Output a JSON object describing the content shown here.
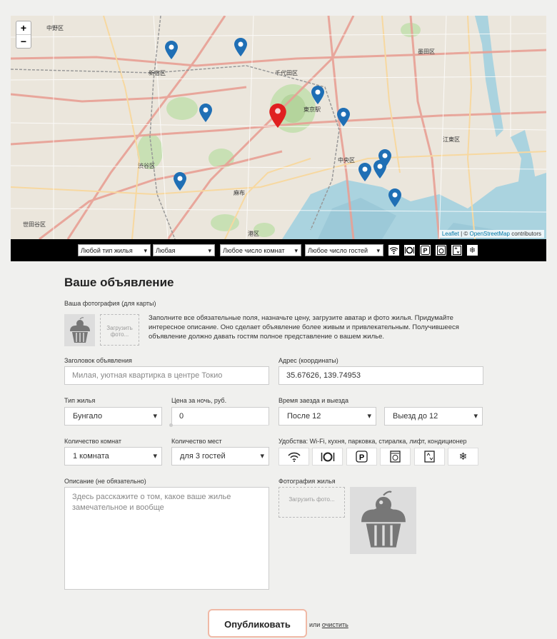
{
  "map": {
    "zoom_in": "+",
    "zoom_out": "−",
    "attribution_leaflet": "Leaflet",
    "attribution_sep": " | © ",
    "attribution_osm": "OpenStreetMap",
    "attribution_tail": " contributors",
    "labels": {
      "nakano": "中野区",
      "shinjuku": "新宿区",
      "shibuya": "渋谷区",
      "setagaya": "世田谷区",
      "chiyoda": "千代田区",
      "tokyo_station": "東京駅",
      "chuo": "中央区",
      "koto": "江東区",
      "sumida": "墨田区",
      "minato": "港区",
      "azabu": "麻布"
    }
  },
  "filters": {
    "type": "Любой тип жилья",
    "price": "Любая",
    "rooms": "Любое число комнат",
    "guests": "Любое число гостей",
    "icons": [
      "wifi-icon",
      "dinner-icon",
      "parking-icon",
      "washer-icon",
      "elevator-icon",
      "snowflake-icon"
    ]
  },
  "form": {
    "title": "Ваше объявление",
    "photo_label": "Ваша фотография (для карты)",
    "upload_small": "Загрузить фото...",
    "intro": "Заполните все обязательные поля, назначьте цену, загрузите аватар и фото жилья. Придумайте интересное описание. Оно сделает объявление более живым и привлекательным. Получившееся объявление должно давать гостям полное представление о вашем жилье.",
    "heading_label": "Заголовок объявления",
    "heading_placeholder": "Милая, уютная квартирка в центре Токио",
    "address_label": "Адрес (координаты)",
    "address_value": "35.67626, 139.74953",
    "type_label": "Тип жилья",
    "type_value": "Бунгало",
    "price_label": "Цена за ночь, руб.",
    "price_value": "0",
    "time_label": "Время заезда и выезда",
    "checkin_value": "После 12",
    "checkout_value": "Выезд до 12",
    "rooms_label": "Количество комнат",
    "rooms_value": "1 комната",
    "guests_label": "Количество мест",
    "guests_value": "для 3 гостей",
    "amenities_label": "Удобства: Wi-Fi, кухня, парковка, стиралка, лифт, кондиционер",
    "desc_label": "Описание (не обязательно)",
    "desc_placeholder": "Здесь расскажите о том, какое ваше жилье замечательное и вообще",
    "photos_label": "Фотография жилья",
    "upload_big": "Загрузить фото...",
    "publish": "Опубликовать",
    "or": "или ",
    "clear": "очистить"
  },
  "colors": {
    "pin_blue": "#1f6fb5",
    "pin_main": "#e02020",
    "water": "#aad3df",
    "park": "#c8e0b4"
  }
}
